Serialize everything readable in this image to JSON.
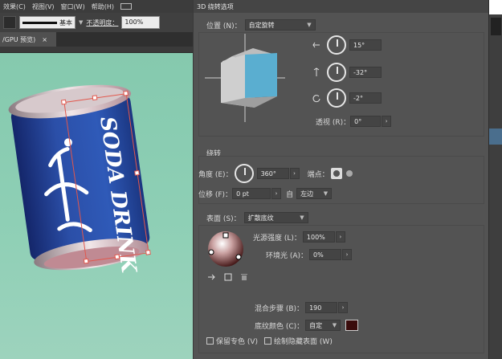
{
  "menubar": {
    "items": [
      "效果(C)",
      "视图(V)",
      "窗口(W)",
      "帮助(H)"
    ]
  },
  "control_bar": {
    "stroke_style": "基本",
    "opacity_label": "不透明度：",
    "opacity_value": "100%"
  },
  "document_tab": {
    "label": "/GPU 预览)",
    "close": "×"
  },
  "artwork": {
    "can_text": "SODA DRINK"
  },
  "dialog": {
    "title": "3D 绕转选项",
    "position": {
      "label": "位置 (N)：",
      "value": "自定旋转",
      "x_angle": "15°",
      "y_angle": "-32°",
      "z_angle": "-2°",
      "perspective_label": "透视 (R)：",
      "perspective_value": "0°"
    },
    "revolve": {
      "section": "绕转",
      "angle_label": "角度 (E)：",
      "angle_value": "360°",
      "cap_label": "端点：",
      "offset_label": "位移 (F)：",
      "offset_value": "0 pt",
      "from_label": "自",
      "from_value": "左边"
    },
    "surface": {
      "label": "表面 (S)：",
      "value": "扩散底纹",
      "light_intensity_label": "光源强度 (L)：",
      "light_intensity_value": "100%",
      "ambient_label": "环境光 (A)：",
      "ambient_value": "0%",
      "blend_steps_label": "混合步骤 (B)：",
      "blend_steps_value": "190",
      "shading_color_label": "底纹颜色 (C)：",
      "shading_color_value": "自定",
      "preserve_spot_label": "保留专色 (V)",
      "draw_hidden_label": "绘制隐藏表面 (W)"
    }
  },
  "colors": {
    "can_blue": "#2b4fa8",
    "canvas_green": "#8ecfb5",
    "cube_front": "#5aaed0",
    "shading_swatch": "#3a0c0c",
    "selection": "#e2574c"
  }
}
